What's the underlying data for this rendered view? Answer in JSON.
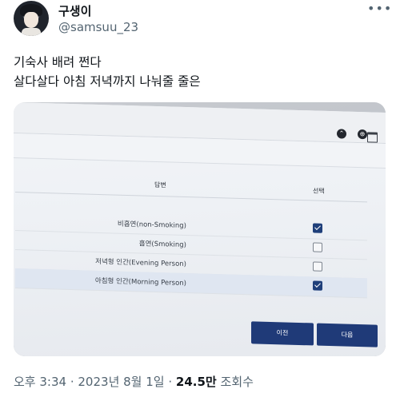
{
  "tweet": {
    "display_name": "구생이",
    "handle": "@samsuu_23",
    "more_icon": "more-horizontal-icon",
    "text_line1": "기숙사 배려 쩐다",
    "text_line2": "살다살다 아침 저녁까지 나눠줄 줄은"
  },
  "photo": {
    "table": {
      "header_answer": "답변",
      "header_select": "선택",
      "rows": [
        {
          "label": "비흡연(non-Smoking)",
          "checked": true
        },
        {
          "label": "흡연(Smoking)",
          "checked": false
        },
        {
          "label": "저녁형 인간(Evening Person)",
          "checked": false
        },
        {
          "label": "아침형 인간(Morning Person)",
          "checked": true
        }
      ]
    },
    "buttons": {
      "prev": "이전",
      "next": "다음"
    }
  },
  "meta": {
    "time": "오후 3:34",
    "date": "2023년 8월 1일",
    "views_count": "24.5만",
    "views_label": "조회수"
  }
}
